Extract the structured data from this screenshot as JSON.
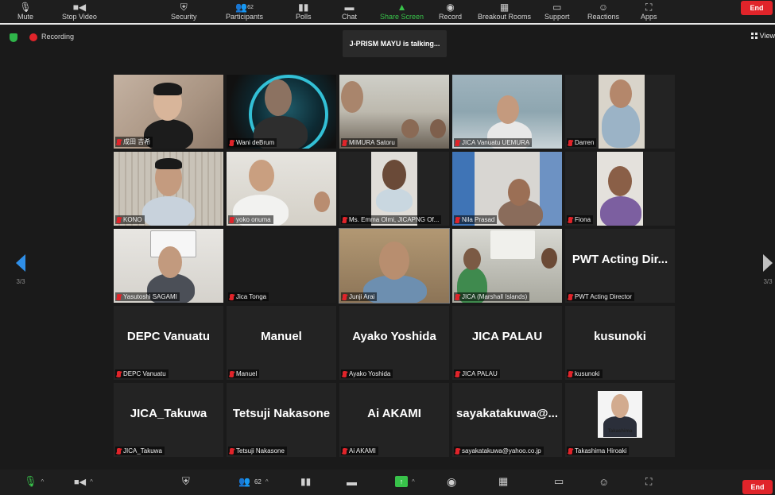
{
  "top_toolbar": {
    "items": [
      {
        "label": "Mute",
        "icon": "microphone-icon"
      },
      {
        "label": "Stop Video",
        "icon": "video-camera-icon"
      },
      {
        "label": "Security",
        "icon": "shield-icon"
      },
      {
        "label": "Participants",
        "icon": "participants-icon",
        "count": "62"
      },
      {
        "label": "Polls",
        "icon": "polls-icon"
      },
      {
        "label": "Chat",
        "icon": "chat-icon"
      },
      {
        "label": "Share Screen",
        "icon": "share-screen-icon"
      },
      {
        "label": "Record",
        "icon": "record-icon"
      },
      {
        "label": "Breakout Rooms",
        "icon": "breakout-rooms-icon"
      },
      {
        "label": "Support",
        "icon": "support-icon"
      },
      {
        "label": "Reactions",
        "icon": "reactions-icon"
      },
      {
        "label": "Apps",
        "icon": "apps-icon"
      }
    ],
    "end_label": "End"
  },
  "status": {
    "recording_label": "Recording",
    "talking_banner": "J-PRISM MAYU is talking...",
    "view_label": "View"
  },
  "pagination": {
    "left_page": "3/3",
    "right_page": "3/3"
  },
  "tiles": [
    {
      "name": "成田 吉希",
      "type": "video"
    },
    {
      "name": "Wani deBrum",
      "type": "video"
    },
    {
      "name": "MIMURA Satoru",
      "type": "video"
    },
    {
      "name": "JICA Vanuatu UEMURA",
      "type": "video"
    },
    {
      "name": "Darren",
      "type": "video"
    },
    {
      "name": "KONO",
      "type": "video"
    },
    {
      "name": "yoko onuma",
      "type": "video"
    },
    {
      "name": "Ms. Emma Olmi, JICAPNG Of...",
      "type": "video"
    },
    {
      "name": "Nila Prasad",
      "type": "video"
    },
    {
      "name": "Fiona",
      "type": "video"
    },
    {
      "name": "Yasutoshi SAGAMI",
      "type": "video"
    },
    {
      "name": "Jica Tonga",
      "type": "video"
    },
    {
      "name": "Junji Arai",
      "type": "video"
    },
    {
      "name": "JICA (Marshall Islands)",
      "type": "video"
    },
    {
      "name": "PWT Acting Director",
      "type": "name",
      "display": "PWT Acting Dir..."
    },
    {
      "name": "DEPC Vanuatu",
      "type": "name",
      "display": "DEPC Vanuatu"
    },
    {
      "name": "Manuel",
      "type": "name",
      "display": "Manuel"
    },
    {
      "name": "Ayako Yoshida",
      "type": "name",
      "display": "Ayako Yoshida"
    },
    {
      "name": "JICA PALAU",
      "type": "name",
      "display": "JICA PALAU"
    },
    {
      "name": "kusunoki",
      "type": "name",
      "display": "kusunoki"
    },
    {
      "name": "JICA_Takuwa",
      "type": "name",
      "display": "JICA_Takuwa"
    },
    {
      "name": "Tetsuji Nakasone",
      "type": "name",
      "display": "Tetsuji Nakasone"
    },
    {
      "name": "Ai AKAMI",
      "type": "name",
      "display": "Ai AKAMI"
    },
    {
      "name": "sayakatakuwa@yahoo.co.jp",
      "type": "name",
      "display": "sayakatakuwa@..."
    },
    {
      "name": "Takashima Hiroaki",
      "type": "photo",
      "photo_caption": "Takashima"
    }
  ],
  "bottom_toolbar": {
    "participants_count": "62",
    "end_label": "End"
  },
  "colors": {
    "background": "#1a1a1a",
    "tile": "#232323",
    "end_red": "#e0242a",
    "share_green": "#38c24a",
    "arrow_blue": "#2f8fe8"
  }
}
